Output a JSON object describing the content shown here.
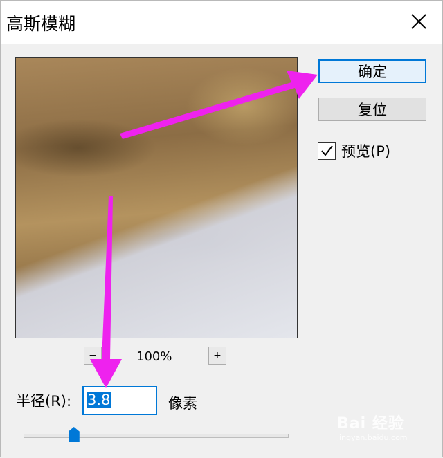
{
  "dialog": {
    "title": "高斯模糊",
    "close_icon": "close-icon"
  },
  "buttons": {
    "ok_label": "确定",
    "reset_label": "复位"
  },
  "preview_option": {
    "label": "预览(P)",
    "checked": true
  },
  "zoom": {
    "minus_label": "−",
    "plus_label": "+",
    "value": "100%"
  },
  "radius": {
    "label": "半径(R):",
    "value": "3.8",
    "unit": "像素",
    "slider_fraction": 0.19
  },
  "annotation": {
    "arrow_color": "#ee22ee"
  },
  "watermark": {
    "main": "Bai 经验",
    "sub": "jingyan.baidu.com"
  },
  "colors": {
    "accent": "#0078d7"
  }
}
